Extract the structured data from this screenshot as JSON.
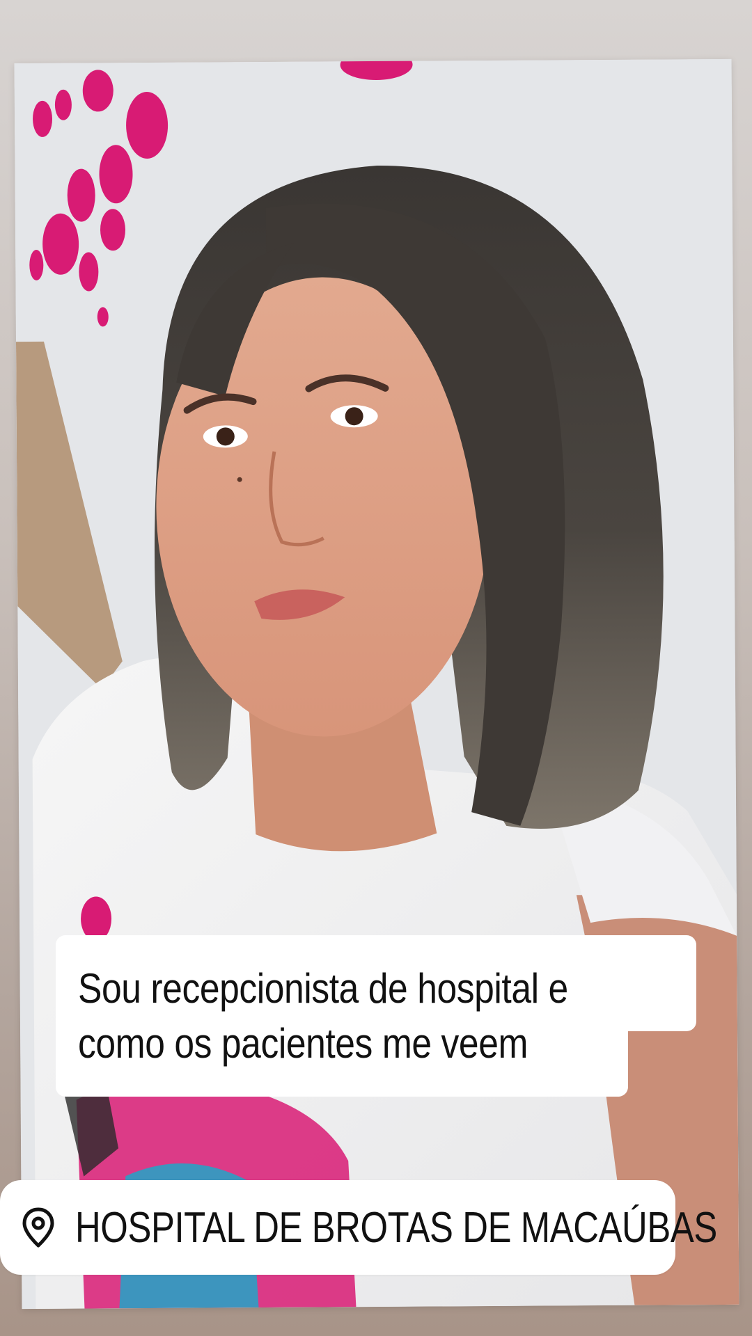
{
  "story": {
    "caption_line_1": "Sou recepcionista de hospital e",
    "caption_line_2": "como os pacientes me veem",
    "location": {
      "icon": "location-pin-icon",
      "label": "HOSPITAL DE BROTAS DE MACAÚBAS"
    }
  },
  "colors": {
    "sticker_background": "#ffffff",
    "text": "#111111",
    "accent_pink": "#d81b74"
  }
}
